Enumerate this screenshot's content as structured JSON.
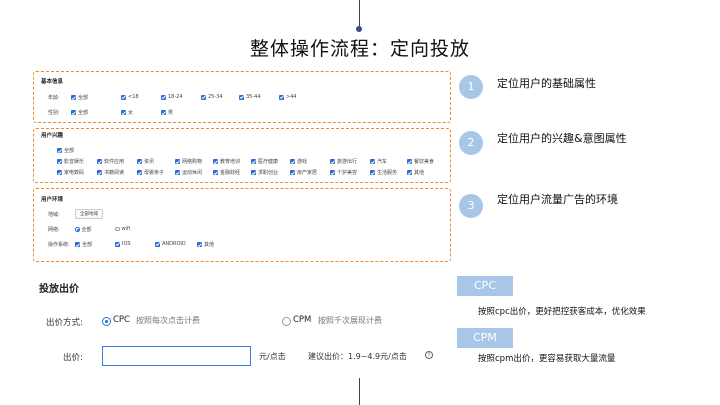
{
  "slide": {
    "title": "整体操作流程：定向投放"
  },
  "basic_info": {
    "title": "基本信息",
    "age_label": "年龄:",
    "age_options": [
      "全部",
      "<18",
      "18-24",
      "25-34",
      "35-44",
      ">44"
    ],
    "gender_label": "性别:",
    "gender_options": [
      "全部",
      "女",
      "男"
    ]
  },
  "interest": {
    "title": "用户兴趣",
    "all": "全部",
    "row1": [
      "影音娱乐",
      "软件应用",
      "资讯",
      "网络购物",
      "教育培训",
      "医疗健康",
      "游戏",
      "旅游出行",
      "汽车",
      "餐饮美食"
    ],
    "row2": [
      "家电数码",
      "书籍阅读",
      "母婴亲子",
      "运动休闲",
      "金融财经",
      "求职创业",
      "房产家居",
      "个护美容",
      "生活服务",
      "其他"
    ]
  },
  "environment": {
    "title": "用户环境",
    "region_label": "地域:",
    "region_button": "全部地域",
    "network_label": "网络:",
    "network_options": [
      "全部",
      "wifi"
    ],
    "os_label": "操作系统:",
    "os_options": [
      "全部",
      "IOS",
      "ANDROID",
      "其他"
    ]
  },
  "steps": [
    {
      "num": "1",
      "text": "定位用户的基础属性"
    },
    {
      "num": "2",
      "text": "定位用户的兴趣&意图属性"
    },
    {
      "num": "3",
      "text": "定位用户流量广告的环境"
    }
  ],
  "bid": {
    "title": "投放出价",
    "method_label": "出价方式:",
    "cpc_label": "CPC",
    "cpc_desc": "按照每次点击计费",
    "cpm_label": "CPM",
    "cpm_desc": "按照千次展现计费",
    "price_label": "出价:",
    "price_value": "",
    "unit": "元/点击",
    "suggest": "建议出价：1.9~4.9元/点击",
    "help": "?"
  },
  "tags": [
    {
      "name": "CPC",
      "desc": "按照cpc出价，更好把控获客成本，优化效果"
    },
    {
      "name": "CPM",
      "desc": "按照cpm出价，更容易获取大量流量"
    }
  ],
  "colors": {
    "accent": "#2d6fd0",
    "dashed_border": "#f0892c",
    "step_circle": "#a8c6e8"
  }
}
